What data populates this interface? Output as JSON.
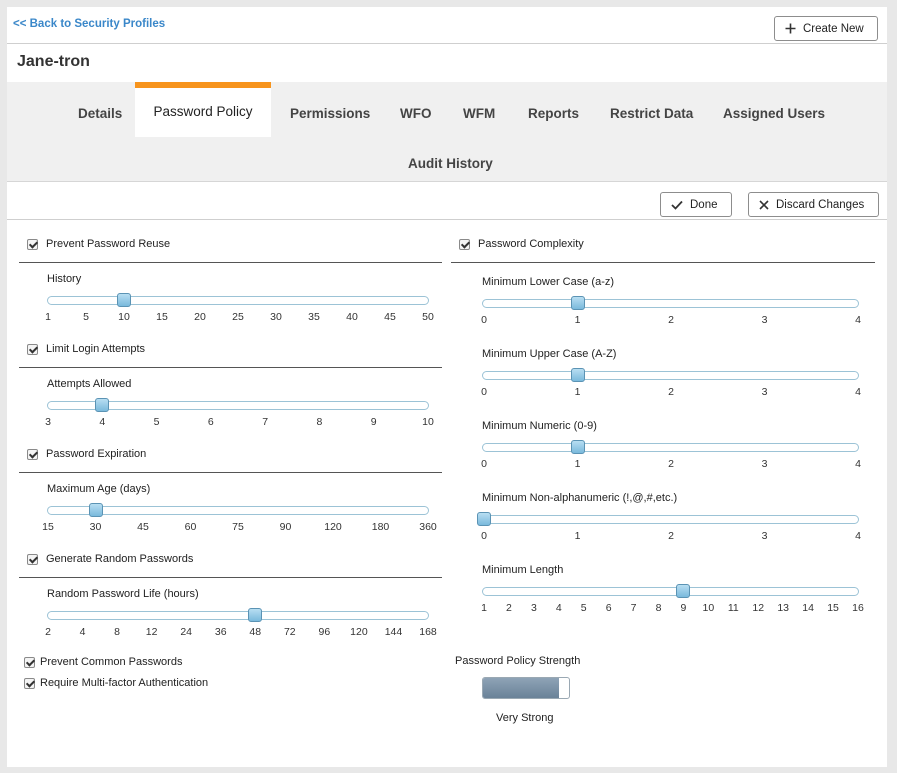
{
  "header": {
    "back_link": "<< Back to Security Profiles",
    "create_new": "Create New"
  },
  "profile": {
    "name": "Jane-tron"
  },
  "tabs": [
    {
      "label": "Details"
    },
    {
      "label": "Password Policy",
      "active": true
    },
    {
      "label": "Permissions"
    },
    {
      "label": "WFO"
    },
    {
      "label": "WFM"
    },
    {
      "label": "Reports"
    },
    {
      "label": "Restrict Data"
    },
    {
      "label": "Assigned Users"
    },
    {
      "label": "Audit History"
    }
  ],
  "actions": {
    "done": "Done",
    "discard": "Discard Changes"
  },
  "left": {
    "sections": [
      {
        "checkbox": "Prevent Password Reuse",
        "checked": true,
        "slider_label": "History",
        "ticks": [
          "1",
          "5",
          "10",
          "15",
          "20",
          "25",
          "30",
          "35",
          "40",
          "45",
          "50"
        ],
        "value": "10"
      },
      {
        "checkbox": "Limit Login Attempts",
        "checked": true,
        "slider_label": "Attempts Allowed",
        "ticks": [
          "3",
          "4",
          "5",
          "6",
          "7",
          "8",
          "9",
          "10"
        ],
        "value": "4"
      },
      {
        "checkbox": "Password Expiration",
        "checked": true,
        "slider_label": "Maximum Age (days)",
        "ticks": [
          "15",
          "30",
          "45",
          "60",
          "75",
          "90",
          "120",
          "180",
          "360"
        ],
        "value": "30"
      },
      {
        "checkbox": "Generate Random Passwords",
        "checked": true,
        "slider_label": "Random Password Life (hours)",
        "ticks": [
          "2",
          "4",
          "8",
          "12",
          "24",
          "36",
          "48",
          "72",
          "96",
          "120",
          "144",
          "168"
        ],
        "value": "48"
      }
    ],
    "extra_checkboxes": [
      {
        "label": "Prevent Common Passwords",
        "checked": true
      },
      {
        "label": "Require Multi-factor Authentication",
        "checked": true
      }
    ]
  },
  "right": {
    "checkbox": "Password Complexity",
    "checked": true,
    "sliders": [
      {
        "label": "Minimum Lower Case (a-z)",
        "ticks": [
          "0",
          "1",
          "2",
          "3",
          "4"
        ],
        "value": "1"
      },
      {
        "label": "Minimum Upper Case (A-Z)",
        "ticks": [
          "0",
          "1",
          "2",
          "3",
          "4"
        ],
        "value": "1"
      },
      {
        "label": "Minimum Numeric (0-9)",
        "ticks": [
          "0",
          "1",
          "2",
          "3",
          "4"
        ],
        "value": "1"
      },
      {
        "label": "Minimum Non-alphanumeric (!,@,#,etc.)",
        "ticks": [
          "0",
          "1",
          "2",
          "3",
          "4"
        ],
        "value": "0"
      },
      {
        "label": "Minimum Length",
        "ticks": [
          "1",
          "2",
          "3",
          "4",
          "5",
          "6",
          "7",
          "8",
          "9",
          "10",
          "11",
          "12",
          "13",
          "14",
          "15",
          "16"
        ],
        "value": "9"
      }
    ],
    "strength": {
      "label": "Password Policy Strength",
      "value_text": "Very Strong",
      "level": 0.88
    }
  }
}
